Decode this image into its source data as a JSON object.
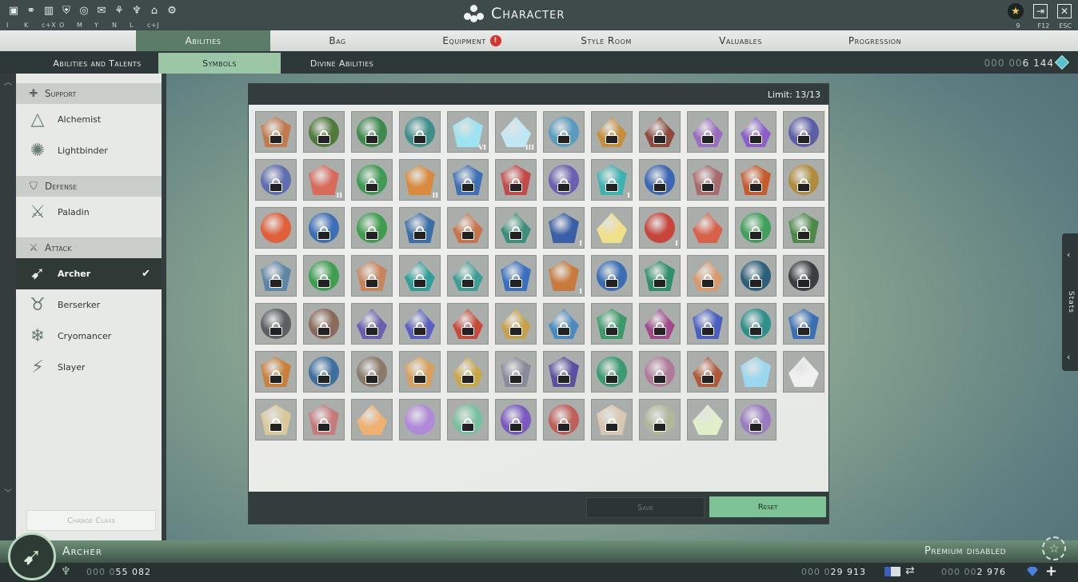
{
  "window": {
    "title": "Character",
    "top_icons": [
      {
        "icon": "journal-icon",
        "glyph": "▣",
        "alert": true
      },
      {
        "icon": "connections-icon",
        "glyph": "⚭",
        "alert": false
      },
      {
        "icon": "stats-icon",
        "glyph": "▥",
        "alert": false
      },
      {
        "icon": "guild-icon",
        "glyph": "⛨",
        "alert": false
      },
      {
        "icon": "atlas-icon",
        "glyph": "◎",
        "alert": false
      },
      {
        "icon": "chat-icon",
        "glyph": "✉",
        "alert": false
      },
      {
        "icon": "handshake-icon",
        "glyph": "⚘",
        "alert": false
      },
      {
        "icon": "faction-icon",
        "glyph": "♆",
        "alert": false
      },
      {
        "icon": "housing-icon",
        "glyph": "⌂",
        "alert": true
      },
      {
        "icon": "settings-icon",
        "glyph": "⚙",
        "alert": false
      }
    ],
    "hotkeys": [
      "I",
      "K",
      "c+X",
      "O",
      "M",
      "Y",
      "N",
      "L",
      "c+J"
    ],
    "right_hotkeys": [
      "9",
      "F12",
      "ESC"
    ]
  },
  "main_tabs": [
    {
      "label": "Abilities",
      "active": true,
      "alert": false
    },
    {
      "label": "Bag",
      "active": false,
      "alert": false
    },
    {
      "label": "Equipment",
      "active": false,
      "alert": true
    },
    {
      "label": "Style Room",
      "active": false,
      "alert": false
    },
    {
      "label": "Valuables",
      "active": false,
      "alert": false
    },
    {
      "label": "Progression",
      "active": false,
      "alert": false
    }
  ],
  "sub_tabs": [
    {
      "label": "Abilities and Talents",
      "active": false
    },
    {
      "label": "Symbols",
      "active": true
    },
    {
      "label": "Divine Abilities",
      "active": false
    }
  ],
  "currency_top": {
    "dim": "000 00",
    "value": "6 144"
  },
  "class_sections": [
    {
      "title": "Support",
      "icon": "support-icon",
      "glyph": "✚",
      "classes": [
        {
          "name": "Alchemist",
          "icon": "alchemist-icon",
          "glyph": "△",
          "active": false
        },
        {
          "name": "Lightbinder",
          "icon": "lightbinder-icon",
          "glyph": "✺",
          "active": false
        }
      ]
    },
    {
      "title": "Defense",
      "icon": "shield-icon",
      "glyph": "⛉",
      "classes": [
        {
          "name": "Paladin",
          "icon": "paladin-icon",
          "glyph": "⚔",
          "active": false
        }
      ]
    },
    {
      "title": "Attack",
      "icon": "sword-icon",
      "glyph": "⚔",
      "classes": [
        {
          "name": "Archer",
          "icon": "archer-icon",
          "glyph": "➹",
          "active": true
        },
        {
          "name": "Berserker",
          "icon": "berserker-icon",
          "glyph": "♉",
          "active": false
        },
        {
          "name": "Cryomancer",
          "icon": "cryomancer-icon",
          "glyph": "❄",
          "active": false
        },
        {
          "name": "Slayer",
          "icon": "slayer-icon",
          "glyph": "⚡",
          "active": false
        }
      ]
    }
  ],
  "change_class_label": "Change Class",
  "symbols": {
    "limit_text": "Limit: 13/13",
    "save_label": "Save",
    "reset_label": "Reset",
    "items": [
      {
        "c": "#c07a4d",
        "s": "hex",
        "l": true,
        "r": ""
      },
      {
        "c": "#4f7a3c",
        "s": "circle",
        "l": true,
        "r": ""
      },
      {
        "c": "#3c8a4e",
        "s": "circle",
        "l": true,
        "r": ""
      },
      {
        "c": "#3e8e8a",
        "s": "circle",
        "l": true,
        "r": ""
      },
      {
        "c": "#9de3f0",
        "s": "hex",
        "l": false,
        "r": "VI"
      },
      {
        "c": "#bfe8f4",
        "s": "gem",
        "l": false,
        "r": "III"
      },
      {
        "c": "#5a9bbf",
        "s": "circle",
        "l": true,
        "r": ""
      },
      {
        "c": "#c88d3a",
        "s": "gem",
        "l": true,
        "r": ""
      },
      {
        "c": "#8d4a3d",
        "s": "gem",
        "l": true,
        "r": ""
      },
      {
        "c": "#9a6cc0",
        "s": "gem",
        "l": true,
        "r": ""
      },
      {
        "c": "#8a5fcb",
        "s": "gem",
        "l": true,
        "r": ""
      },
      {
        "c": "#5e5ea8",
        "s": "circle",
        "l": true,
        "r": ""
      },
      {
        "c": "#5e6eb0",
        "s": "circle",
        "l": true,
        "r": ""
      },
      {
        "c": "#d96a5a",
        "s": "hex",
        "l": false,
        "r": "II"
      },
      {
        "c": "#3f9b54",
        "s": "circle",
        "l": true,
        "r": ""
      },
      {
        "c": "#d98a3c",
        "s": "hex",
        "l": false,
        "r": "II"
      },
      {
        "c": "#3f70b5",
        "s": "hex",
        "l": true,
        "r": ""
      },
      {
        "c": "#c44a4a",
        "s": "hex",
        "l": true,
        "r": ""
      },
      {
        "c": "#6a5fb0",
        "s": "circle",
        "l": true,
        "r": ""
      },
      {
        "c": "#3cb3b3",
        "s": "hex",
        "l": true,
        "r": "I"
      },
      {
        "c": "#3a66b3",
        "s": "circle",
        "l": true,
        "r": ""
      },
      {
        "c": "#a86a6a",
        "s": "hex",
        "l": true,
        "r": ""
      },
      {
        "c": "#c85a2c",
        "s": "hex",
        "l": true,
        "r": ""
      },
      {
        "c": "#b08c3c",
        "s": "circle",
        "l": true,
        "r": ""
      },
      {
        "c": "#e0603c",
        "s": "circle",
        "l": false,
        "r": ""
      },
      {
        "c": "#3c6fb5",
        "s": "circle",
        "l": true,
        "r": ""
      },
      {
        "c": "#3e9d4f",
        "s": "circle",
        "l": true,
        "r": ""
      },
      {
        "c": "#3b6ea8",
        "s": "hex",
        "l": true,
        "r": ""
      },
      {
        "c": "#c8734a",
        "s": "gem",
        "l": true,
        "r": ""
      },
      {
        "c": "#3c8f7a",
        "s": "gem",
        "l": true,
        "r": ""
      },
      {
        "c": "#3a5fa8",
        "s": "hex",
        "l": false,
        "r": "I"
      },
      {
        "c": "#f0e08a",
        "s": "gem",
        "l": false,
        "r": ""
      },
      {
        "c": "#c8453c",
        "s": "circle",
        "l": false,
        "r": "I"
      },
      {
        "c": "#d8614a",
        "s": "gem",
        "l": false,
        "r": ""
      },
      {
        "c": "#3ea05a",
        "s": "circle",
        "l": true,
        "r": ""
      },
      {
        "c": "#4d8a4a",
        "s": "hex",
        "l": true,
        "r": ""
      },
      {
        "c": "#5e86a8",
        "s": "hex",
        "l": true,
        "r": ""
      },
      {
        "c": "#3da050",
        "s": "circle",
        "l": true,
        "r": ""
      },
      {
        "c": "#c8845a",
        "s": "hex",
        "l": true,
        "r": ""
      },
      {
        "c": "#2e9e98",
        "s": "gem",
        "l": true,
        "r": ""
      },
      {
        "c": "#3c9e94",
        "s": "gem",
        "l": true,
        "r": ""
      },
      {
        "c": "#3a6fc0",
        "s": "hex",
        "l": true,
        "r": ""
      },
      {
        "c": "#c87a3c",
        "s": "hex",
        "l": false,
        "r": "I"
      },
      {
        "c": "#3a6db5",
        "s": "circle",
        "l": true,
        "r": ""
      },
      {
        "c": "#2f8f6a",
        "s": "hex",
        "l": true,
        "r": ""
      },
      {
        "c": "#d89a6a",
        "s": "gem",
        "l": true,
        "r": ""
      },
      {
        "c": "#2d5f7a",
        "s": "circle",
        "l": true,
        "r": ""
      },
      {
        "c": "#3a3f44",
        "s": "circle",
        "l": true,
        "r": ""
      },
      {
        "c": "#5c6063",
        "s": "circle",
        "l": true,
        "r": ""
      },
      {
        "c": "#8a6a5a",
        "s": "circle",
        "l": true,
        "r": ""
      },
      {
        "c": "#6a5fb0",
        "s": "gem",
        "l": true,
        "r": ""
      },
      {
        "c": "#5a5fc0",
        "s": "gem",
        "l": true,
        "r": ""
      },
      {
        "c": "#c84a3a",
        "s": "gem",
        "l": true,
        "r": ""
      },
      {
        "c": "#c8a04a",
        "s": "gem",
        "l": true,
        "r": ""
      },
      {
        "c": "#4a8abf",
        "s": "gem",
        "l": true,
        "r": ""
      },
      {
        "c": "#3a9a6a",
        "s": "hex",
        "l": true,
        "r": ""
      },
      {
        "c": "#a04a8a",
        "s": "gem",
        "l": true,
        "r": ""
      },
      {
        "c": "#4a5fc0",
        "s": "hex",
        "l": true,
        "r": ""
      },
      {
        "c": "#2f8f8a",
        "s": "circle",
        "l": true,
        "r": ""
      },
      {
        "c": "#3a6fb5",
        "s": "hex",
        "l": true,
        "r": ""
      },
      {
        "c": "#c8803a",
        "s": "hex",
        "l": true,
        "r": ""
      },
      {
        "c": "#3e6fa0",
        "s": "circle",
        "l": true,
        "r": ""
      },
      {
        "c": "#8a7a6a",
        "s": "circle",
        "l": true,
        "r": ""
      },
      {
        "c": "#d8a05a",
        "s": "hex",
        "l": true,
        "r": ""
      },
      {
        "c": "#c8a84a",
        "s": "gem",
        "l": true,
        "r": ""
      },
      {
        "c": "#8a8a9a",
        "s": "hex",
        "l": true,
        "r": ""
      },
      {
        "c": "#5a4fa0",
        "s": "hex",
        "l": true,
        "r": ""
      },
      {
        "c": "#3a9a70",
        "s": "circle",
        "l": true,
        "r": ""
      },
      {
        "c": "#b07a9a",
        "s": "circle",
        "l": true,
        "r": ""
      },
      {
        "c": "#b05a3a",
        "s": "gem",
        "l": true,
        "r": ""
      },
      {
        "c": "#9ad8f0",
        "s": "hex",
        "l": false,
        "r": ""
      },
      {
        "c": "#f0f0f0",
        "s": "gem",
        "l": false,
        "r": ""
      },
      {
        "c": "#d8c89a",
        "s": "hex",
        "l": true,
        "r": ""
      },
      {
        "c": "#c87a7a",
        "s": "hex",
        "l": true,
        "r": ""
      },
      {
        "c": "#f0b070",
        "s": "gem",
        "l": false,
        "r": ""
      },
      {
        "c": "#b08ad8",
        "s": "circle",
        "l": false,
        "r": ""
      },
      {
        "c": "#7ac0a0",
        "s": "circle",
        "l": true,
        "r": ""
      },
      {
        "c": "#7a5ac0",
        "s": "circle",
        "l": true,
        "r": ""
      },
      {
        "c": "#c0605a",
        "s": "circle",
        "l": true,
        "r": ""
      },
      {
        "c": "#d8c8b0",
        "s": "hex",
        "l": true,
        "r": ""
      },
      {
        "c": "#b0b89a",
        "s": "circle",
        "l": true,
        "r": ""
      },
      {
        "c": "#e0f0c8",
        "s": "gem",
        "l": false,
        "r": ""
      },
      {
        "c": "#9a7ac0",
        "s": "circle",
        "l": true,
        "r": ""
      }
    ]
  },
  "stats_label": "Stats",
  "bottom": {
    "class_name": "Archer",
    "premium_text": "Premium disabled",
    "currency_left": {
      "dim": "000 0",
      "value": "55 082"
    },
    "currency_mid": {
      "dim": "000 0",
      "value": "29 913"
    },
    "currency_right": {
      "dim": "000 00",
      "value": "2 976"
    }
  }
}
